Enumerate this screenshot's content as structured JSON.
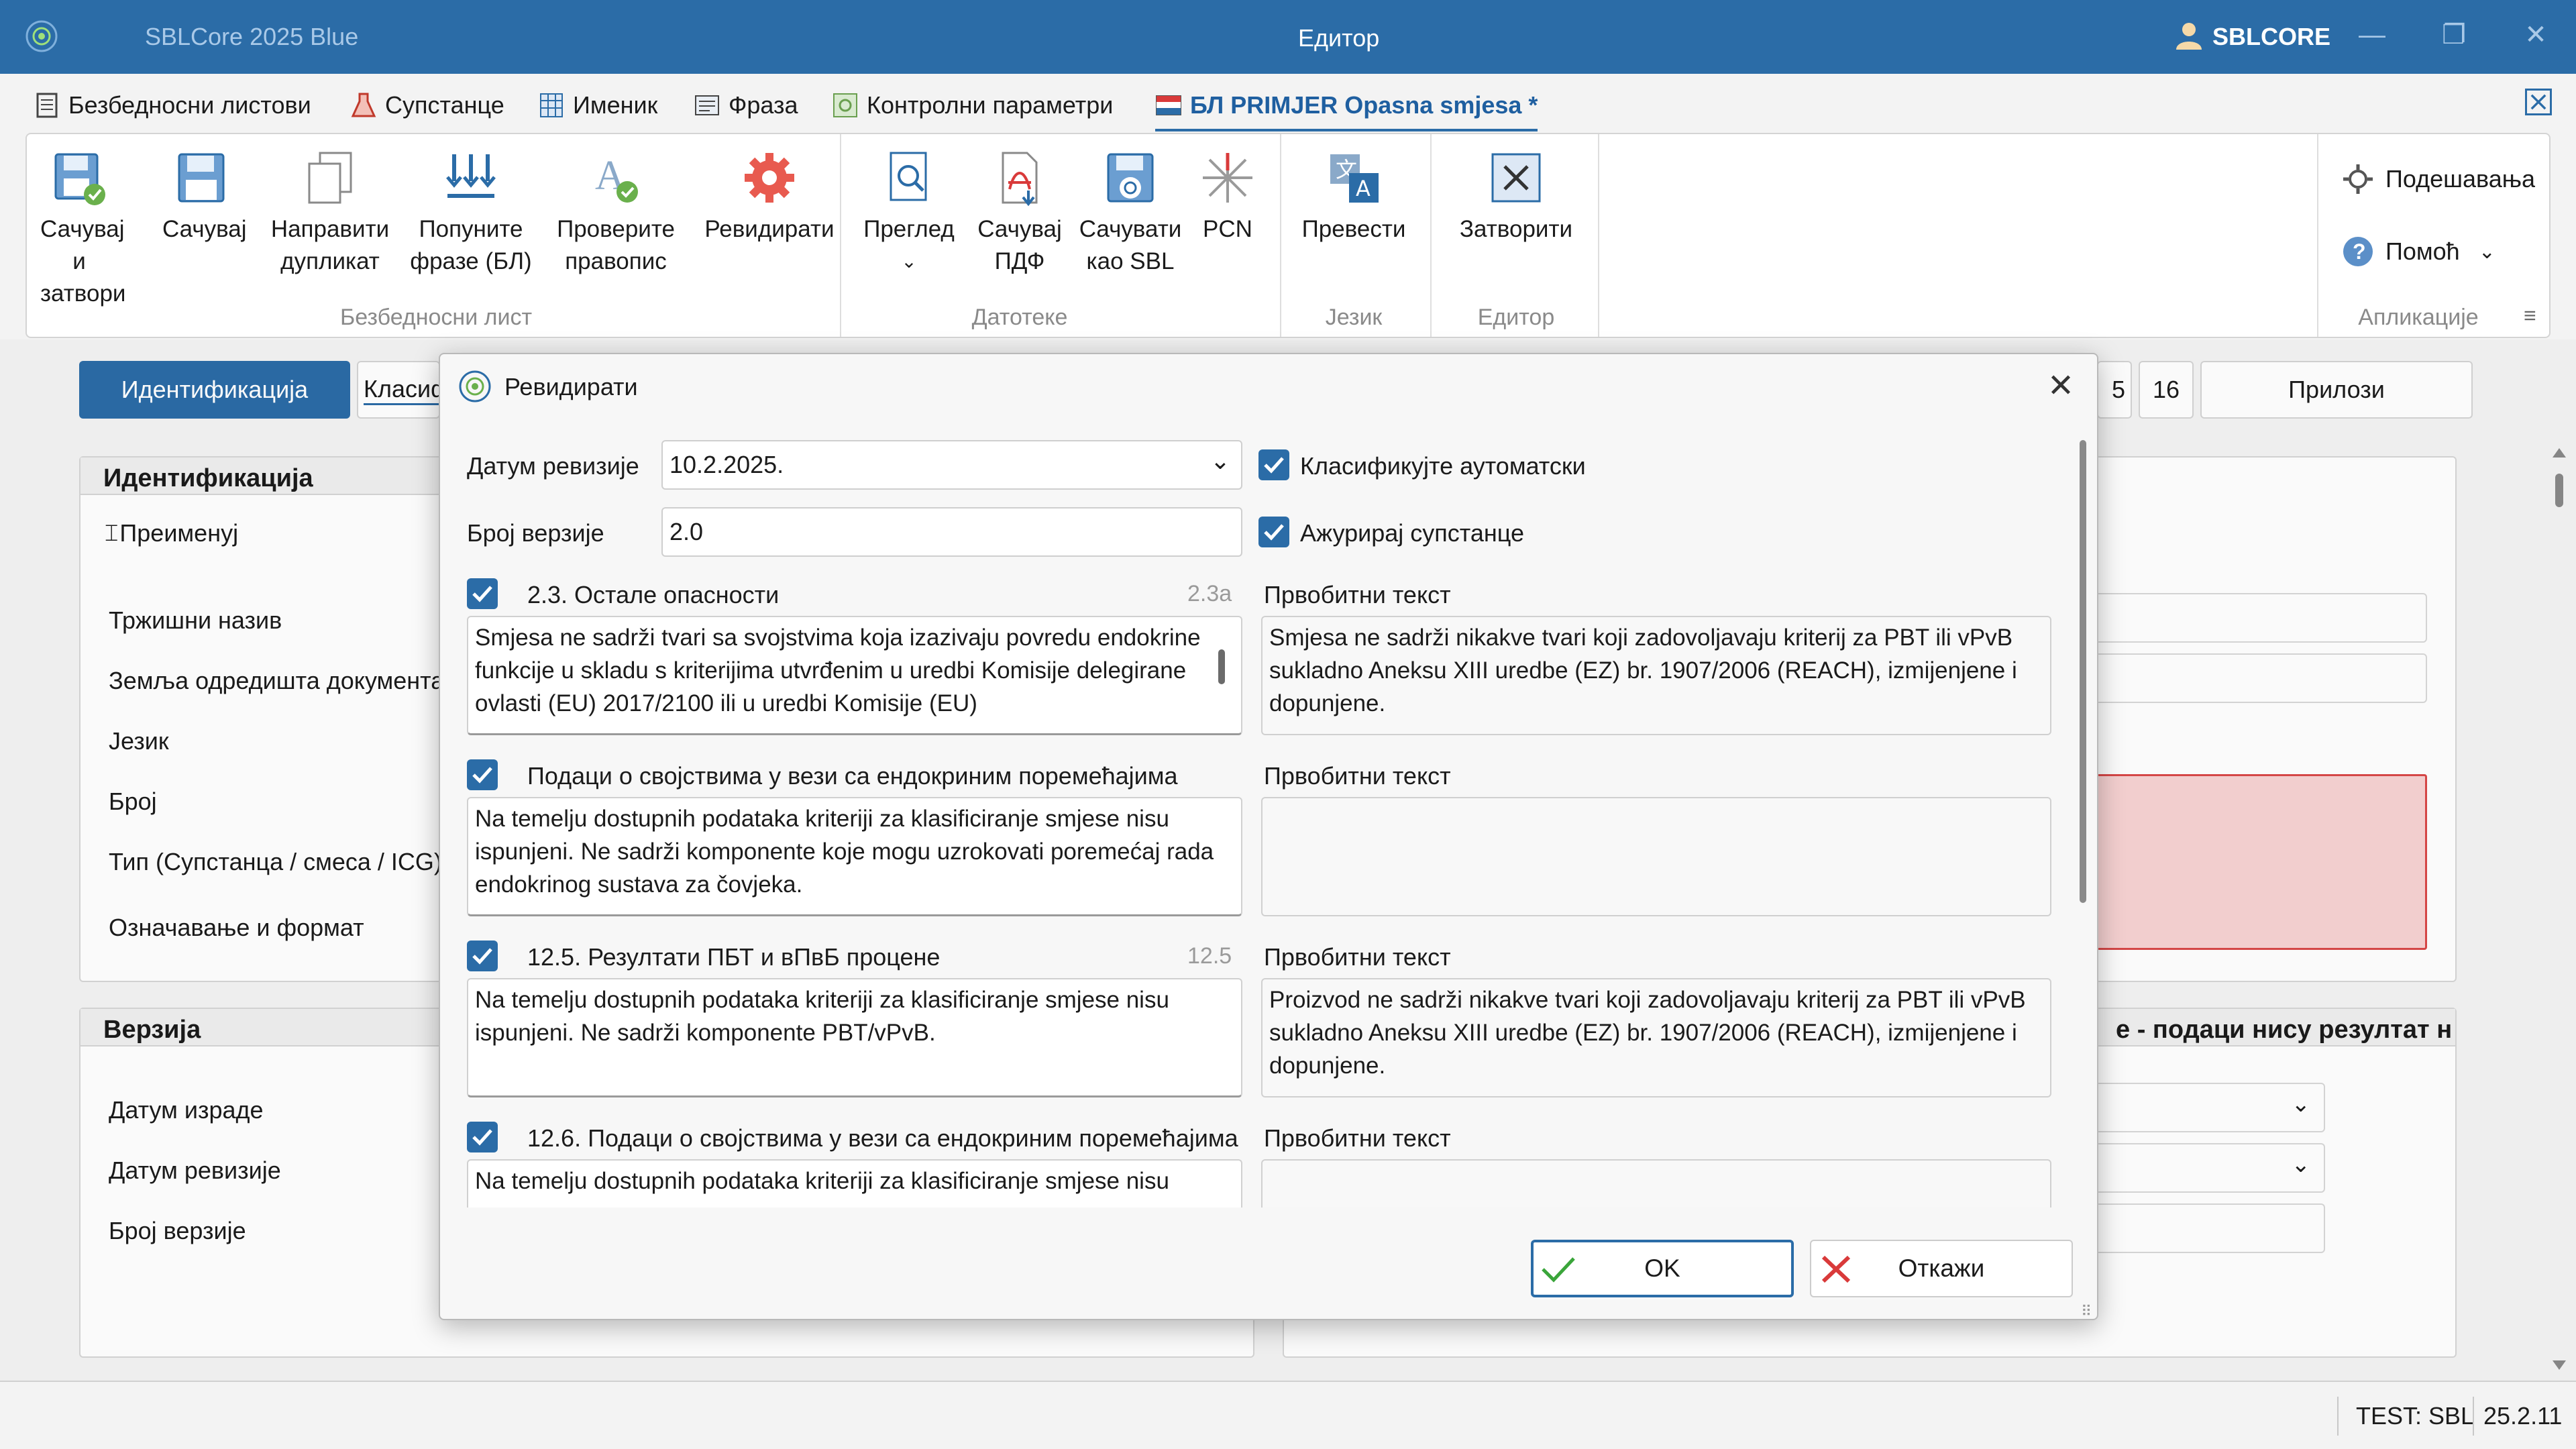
{
  "titlebar": {
    "app_name": "SBLCore 2025 Blue",
    "title": "Едитор",
    "user": "SBLCORE"
  },
  "tabs": [
    {
      "label": "Безбедносни листови",
      "icon": "document-list-icon"
    },
    {
      "label": "Супстанце",
      "icon": "flask-icon"
    },
    {
      "label": "Именик",
      "icon": "grid-icon"
    },
    {
      "label": "Фраза",
      "icon": "phrase-book-icon"
    },
    {
      "label": "Контролни параметри",
      "icon": "control-parameters-icon"
    },
    {
      "label": "БЛ PRIMJER Opasna smjesa *",
      "icon": "flag-document-icon",
      "active": true
    }
  ],
  "ribbon": {
    "groups": [
      {
        "label": "Безбедносни лист"
      },
      {
        "label": "Датотеке"
      },
      {
        "label": "Језик"
      },
      {
        "label": "Едитор"
      },
      {
        "label": "Апликације"
      }
    ],
    "buttons": {
      "save_close": [
        "Сачувај и",
        "затвори"
      ],
      "save": "Сачувај",
      "duplicate": [
        "Направити",
        "дупликат"
      ],
      "fill_phrases": [
        "Попуните",
        "фразе (БЛ)"
      ],
      "spellcheck": [
        "Проверите",
        "правопис"
      ],
      "revise": "Ревидирати",
      "preview": "Преглед",
      "save_pdf": [
        "Сачувај",
        "ПДФ"
      ],
      "save_sbl": [
        "Сачувати",
        "као SBL"
      ],
      "pcn": "PCN",
      "translate": "Превести",
      "close": "Затворити",
      "settings": "Подешавања",
      "help": "Помоћ"
    }
  },
  "page_tabs": {
    "identification": "Идентификација",
    "classification_partial": "Класиф",
    "num5_partial": "5",
    "num16": "16",
    "attachments": "Прилози"
  },
  "identification_panel": {
    "header": "Идентификација",
    "rename": "Преименуј",
    "fields": [
      "Тржишни назив",
      "Земља одредишта документа",
      "Језик",
      "Број",
      "Тип (Супстанца / смеса / ICG)",
      "Означавање и формат"
    ]
  },
  "version_panel": {
    "header": "Верзија",
    "fields": [
      "Датум израде",
      "Датум ревизије",
      "Број верзије"
    ]
  },
  "right_panel_header_partial": "е - подаци нису резултат н",
  "statusbar": {
    "test": "TEST: SBL",
    "version": "25.2.11"
  },
  "dialog": {
    "title": "Ревидирати",
    "revision_date_label": "Датум ревизије",
    "revision_date_value": "10.2.2025.",
    "version_label": "Број верзије",
    "version_value": "2.0",
    "auto_classify_label": "Класификујте аутоматски",
    "auto_classify_checked": true,
    "update_substances_label": "Ажурирај супстанце",
    "update_substances_checked": true,
    "original_text_label": "Првобитни текст",
    "sections": [
      {
        "title": "2.3. Остале опасности",
        "code": "2.3a",
        "checked": true,
        "new_text": "Smjesa ne sadrži tvari sa svojstvima koja izazivaju povredu endokrine funkcije u skladu s kriterijima utvrđenim u uredbi Komisije delegirane ovlasti (EU) 2017/2100 ili u uredbi Komisije (EU)",
        "original_text": "Smjesa ne sadrži nikakve tvari koji zadovoljavaju kriterij za PBT ili vPvB sukladno Aneksu XIII uredbe (EZ) br. 1907/2006 (REACH), izmijenjene i dopunjene."
      },
      {
        "title": "Подаци о својствима у вези са ендокриним поремећајима",
        "code": "",
        "checked": true,
        "new_text": "Na temelju dostupnih podataka kriteriji za klasificiranje smjese nisu ispunjeni. Ne sadrži komponente koje mogu uzrokovati poremećaj rada endokrinog sustava za čovjeka.",
        "original_text": ""
      },
      {
        "title": "12.5. Резултати ПБТ и вПвБ процене",
        "code": "12.5",
        "checked": true,
        "new_text": "Na temelju dostupnih podataka kriteriji za klasificiranje smjese nisu ispunjeni. Ne sadrži komponente PBT/vPvB.",
        "original_text": "Proizvod ne sadrži nikakve tvari koji zadovoljavaju kriterij za PBT ili vPvB sukladno Aneksu XIII uredbe (EZ) br. 1907/2006 (REACH), izmijenjene i dopunjene."
      },
      {
        "title": "12.6. Подаци о својствима у вези са ендокриним поремећајима",
        "code": "",
        "checked": true,
        "new_text": "Na temelju dostupnih podataka kriteriji za klasificiranje smjese nisu",
        "original_text": ""
      }
    ],
    "ok_label": "OK",
    "cancel_label": "Откажи"
  },
  "colors": {
    "titlebar": "#2b6ca7",
    "accent": "#2b6ca7",
    "error_field": "#f7d3d3"
  }
}
